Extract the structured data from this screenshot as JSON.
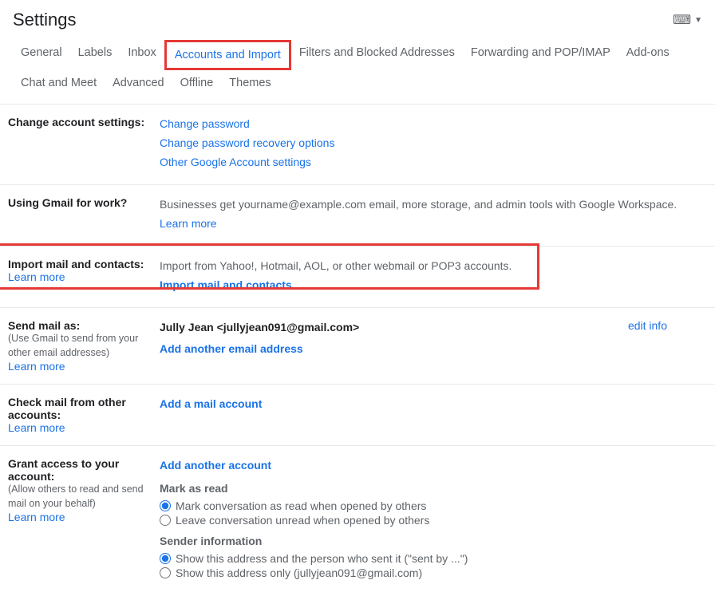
{
  "header": {
    "title": "Settings"
  },
  "tabs": {
    "row1": [
      "General",
      "Labels",
      "Inbox",
      "Accounts and Import",
      "Filters and Blocked Addresses",
      "Forwarding and POP/IMAP",
      "Add-ons"
    ],
    "row2": [
      "Chat and Meet",
      "Advanced",
      "Offline",
      "Themes"
    ],
    "active": "Accounts and Import"
  },
  "sections": {
    "change_account": {
      "label": "Change account settings:",
      "links": [
        "Change password",
        "Change password recovery options",
        "Other Google Account settings"
      ]
    },
    "work": {
      "label": "Using Gmail for work?",
      "text": "Businesses get yourname@example.com email, more storage, and admin tools with Google Workspace.",
      "learn": "Learn more"
    },
    "import": {
      "label": "Import mail and contacts:",
      "learn": "Learn more",
      "text": "Import from Yahoo!, Hotmail, AOL, or other webmail or POP3 accounts.",
      "action": "Import mail and contacts"
    },
    "send_as": {
      "label": "Send mail as:",
      "sub": "(Use Gmail to send from your other email addresses)",
      "learn": "Learn more",
      "identity": "Jully Jean <jullyjean091@gmail.com>",
      "add": "Add another email address",
      "edit": "edit info"
    },
    "check_mail": {
      "label": "Check mail from other accounts:",
      "learn": "Learn more",
      "add": "Add a mail account"
    },
    "grant": {
      "label": "Grant access to your account:",
      "sub": "(Allow others to read and send mail on your behalf)",
      "learn": "Learn more",
      "add": "Add another account",
      "mark_head": "Mark as read",
      "mark1": "Mark conversation as read when opened by others",
      "mark2": "Leave conversation unread when opened by others",
      "sender_head": "Sender information",
      "sender1": "Show this address and the person who sent it (\"sent by ...\")",
      "sender2": "Show this address only (jullyjean091@gmail.com)"
    }
  }
}
